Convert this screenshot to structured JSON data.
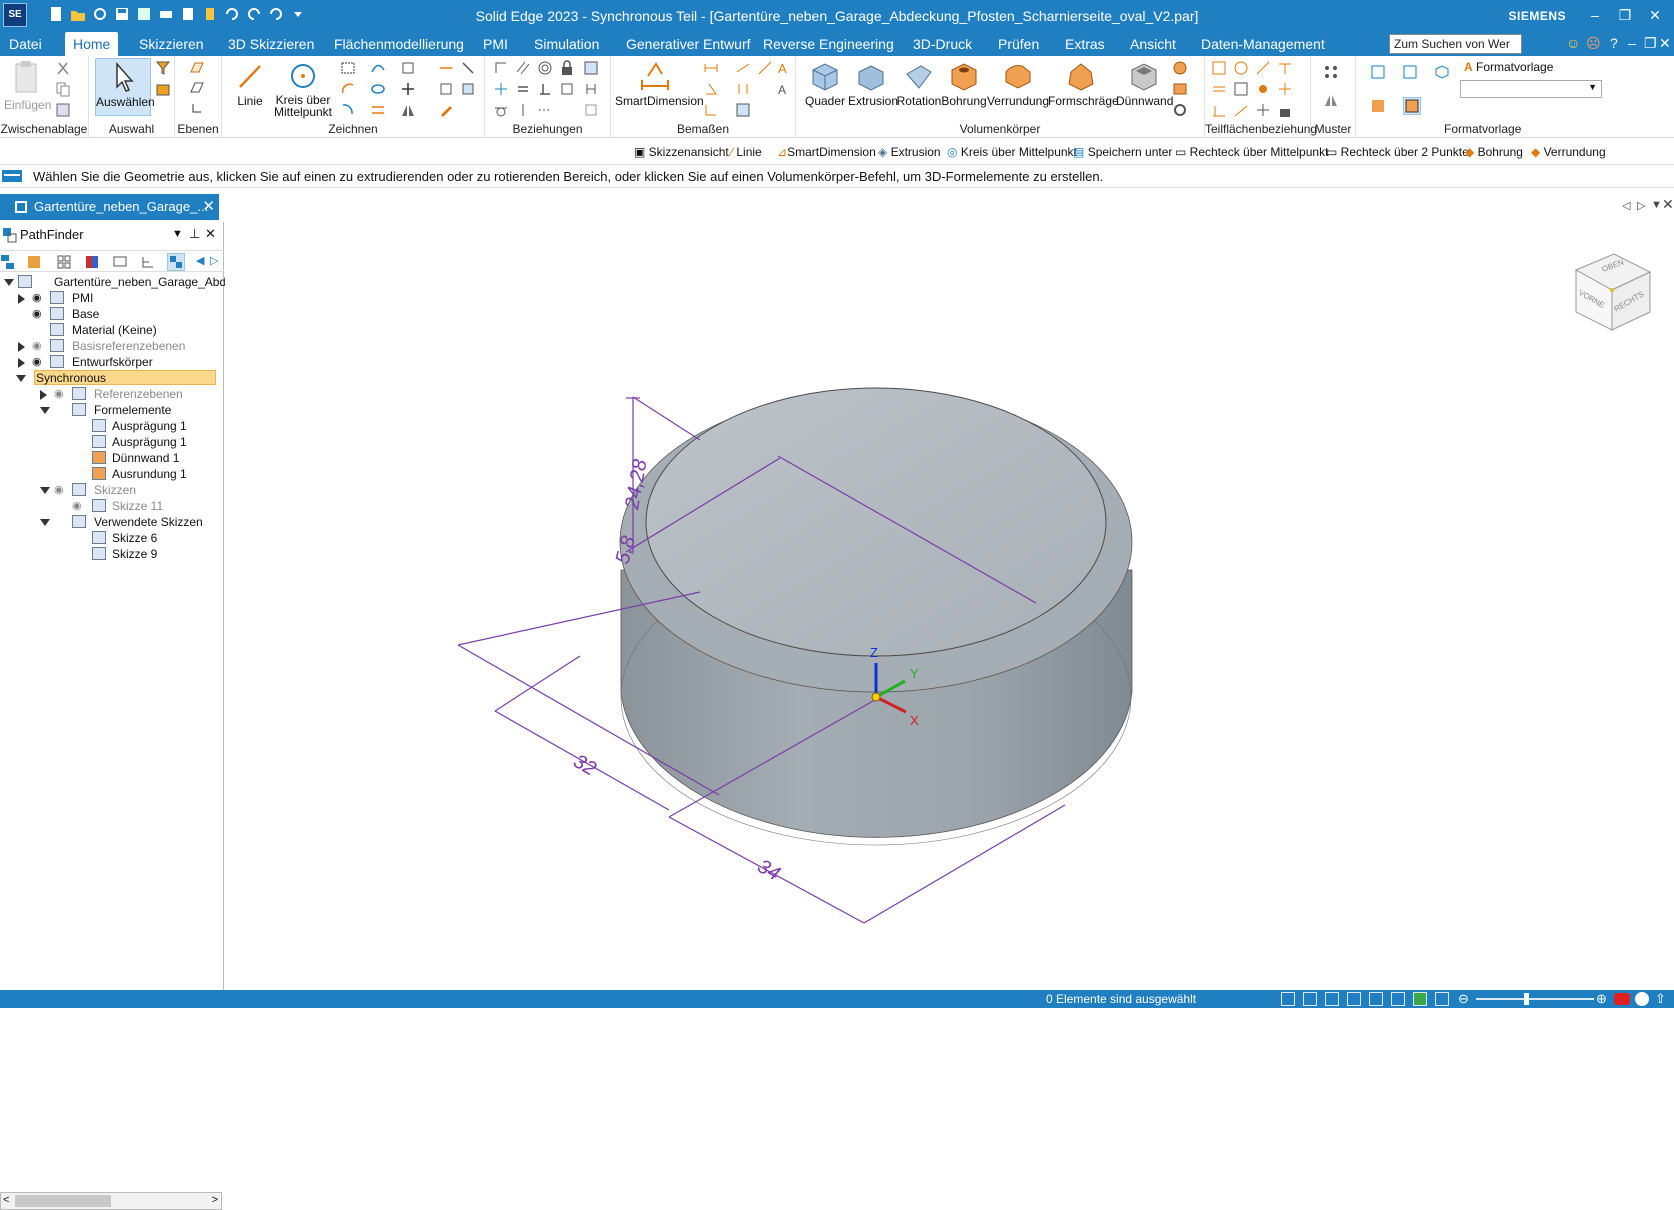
{
  "app": {
    "title": "Solid Edge 2023 - Synchronous Teil - [Gartentüre_neben_Garage_Abdeckung_Pfosten_Scharnierseite_oval_V2.par]",
    "logo": "SE",
    "brand": "SIEMENS",
    "window_controls": [
      "–",
      "❐",
      "✕"
    ]
  },
  "menu": {
    "items": [
      "Datei",
      "Home",
      "Skizzieren",
      "3D Skizzieren",
      "Flächenmodellierung",
      "PMI",
      "Simulation",
      "Generativer Entwurf",
      "Reverse Engineering",
      "3D-Druck",
      "Prüfen",
      "Extras",
      "Ansicht",
      "Daten-Management"
    ],
    "active": "Home",
    "search_placeholder": "Zum Suchen von Wer",
    "right_icons": [
      "☺",
      "☹",
      "?",
      "–",
      "❐",
      "✕"
    ]
  },
  "ribbon": {
    "groups": [
      "Zwischenablage",
      "Auswahl",
      "Ebenen",
      "Zeichnen",
      "Beziehungen",
      "Bemaßen",
      "Volumenkörper",
      "Teilflächenbeziehung",
      "Muster",
      "Formatvorlage"
    ],
    "buttons": {
      "paste": "Einfügen",
      "select": "Auswählen",
      "line": "Linie",
      "circle_l1": "Kreis über",
      "circle_l2": "Mittelpunkt",
      "smartdim": "SmartDimension",
      "quader": "Quader",
      "extrusion": "Extrusion",
      "rotation": "Rotation",
      "bohrung": "Bohrung",
      "verrundung": "Verrundung",
      "formschraege": "Formschräge",
      "duennwand": "Dünnwand",
      "formatvorlage": "Formatvorlage"
    }
  },
  "cmdbar": [
    "Skizzenansicht",
    "Linie",
    "SmartDimension",
    "Extrusion",
    "Kreis über Mittelpunkt",
    "Speichern unter",
    "Rechteck über Mittelpunkt",
    "Rechteck über 2 Punkte",
    "Bohrung",
    "Verrundung"
  ],
  "prompt": "Wählen Sie die Geometrie aus, klicken Sie auf einen zu extrudierenden oder zu rotierenden Bereich, oder klicken Sie auf einen Volumenkörper-Befehl, um 3D-Formelemente zu erstellen.",
  "doc_tab": "Gartentüre_neben_Garage_...",
  "pathfinder": {
    "title": "PathFinder",
    "tree": [
      {
        "label": "Gartentüre_neben_Garage_Abde",
        "level": 0,
        "toggle": "d"
      },
      {
        "label": "PMI",
        "level": 1,
        "toggle": "r",
        "eye": true
      },
      {
        "label": "Base",
        "level": 1,
        "eye": true
      },
      {
        "label": "Material (Keine)",
        "level": 1
      },
      {
        "label": "Basisreferenzebenen",
        "level": 1,
        "toggle": "r",
        "eye": true,
        "grey": true
      },
      {
        "label": "Entwurfskörper",
        "level": 1,
        "toggle": "r",
        "eye": true
      },
      {
        "label": "Synchronous",
        "level": 0.5,
        "toggle": "d",
        "highlight": true
      },
      {
        "label": "Referenzebenen",
        "level": 2,
        "toggle": "r",
        "eye": true,
        "grey": true
      },
      {
        "label": "Formelemente",
        "level": 2,
        "toggle": "d"
      },
      {
        "label": "Ausprägung 1",
        "level": 3
      },
      {
        "label": "Ausprägung 1",
        "level": 3
      },
      {
        "label": "Dünnwand 1",
        "level": 3
      },
      {
        "label": "Ausrundung 1",
        "level": 3
      },
      {
        "label": "Skizzen",
        "level": 2,
        "toggle": "d",
        "eye": true,
        "grey": true
      },
      {
        "label": "Skizze 11",
        "level": 3,
        "eye": true,
        "grey": true
      },
      {
        "label": "Verwendete Skizzen",
        "level": 2,
        "toggle": "d"
      },
      {
        "label": "Skizze 6",
        "level": 3
      },
      {
        "label": "Skizze 9",
        "level": 3
      }
    ]
  },
  "viewport": {
    "dimensions": [
      "24,28",
      "5,8",
      "32",
      "34"
    ],
    "axes": [
      "Z",
      "Y",
      "X"
    ],
    "viewcube": [
      "OBEN",
      "VORNE",
      "RECHTS"
    ]
  },
  "status": {
    "text": "0 Elemente sind ausgewählt"
  },
  "colors": {
    "accent": "#1f7fc0",
    "dimension": "#7a3ca8",
    "part": "#a9b1b8"
  }
}
